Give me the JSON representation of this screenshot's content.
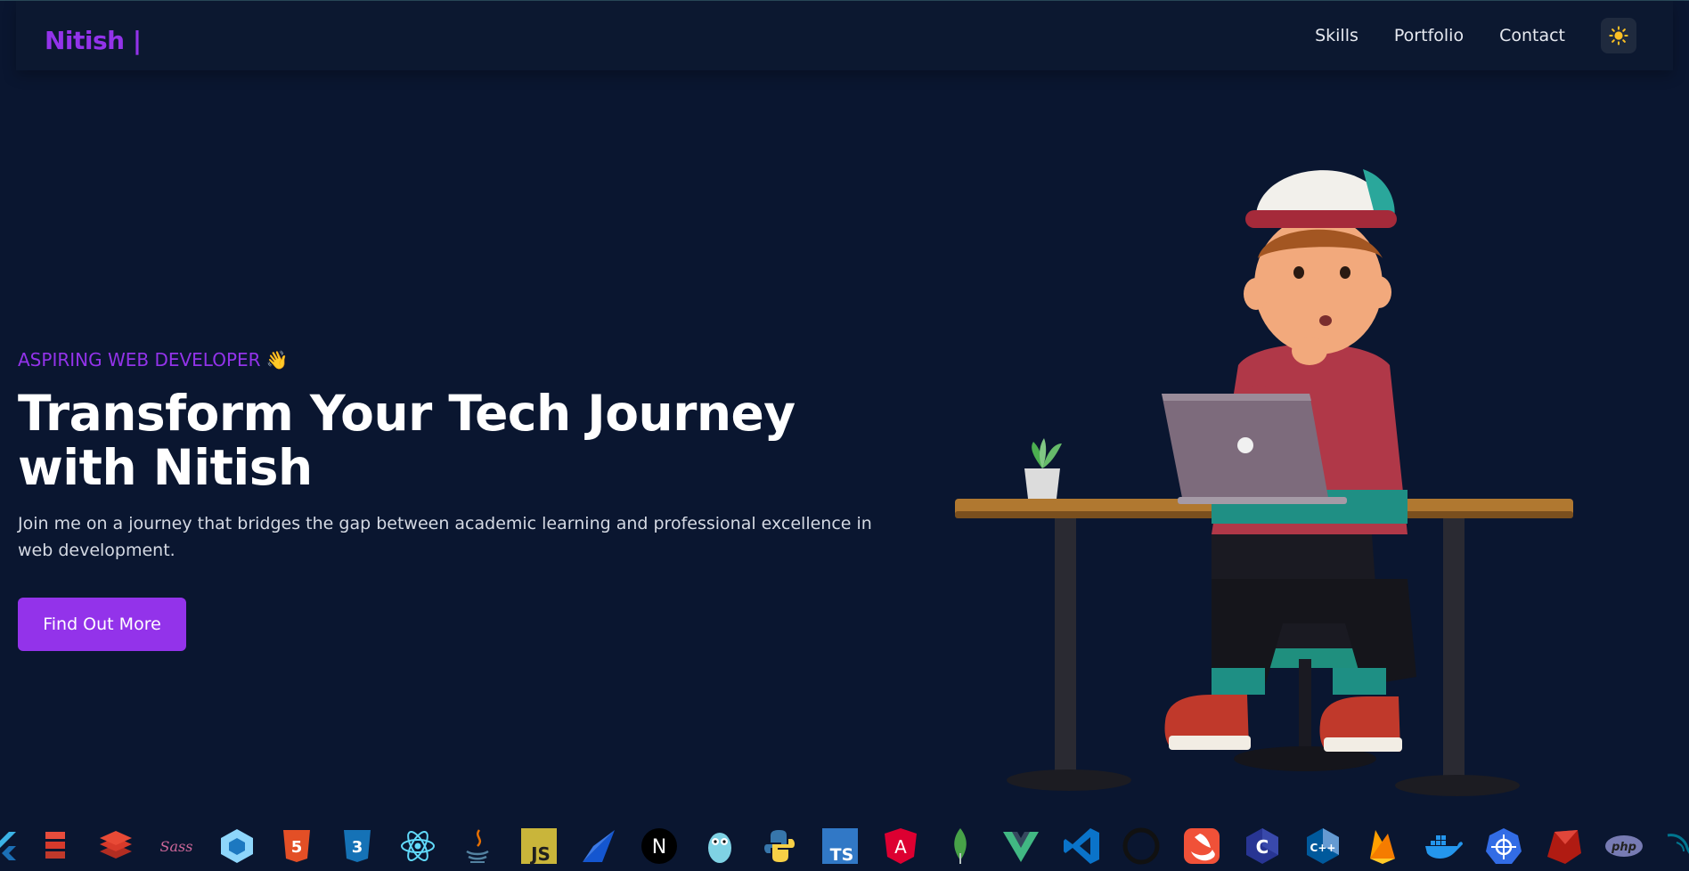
{
  "nav": {
    "logo": "Nitish |",
    "links": [
      "Skills",
      "Portfolio",
      "Contact"
    ],
    "theme_icon": "sun-icon"
  },
  "hero": {
    "eyebrow": "ASPIRING WEB DEVELOPER 👋",
    "title_line1": "Transform Your Tech Journey",
    "title_line2": "with Nitish",
    "description": "Join me on a journey that bridges the gap between academic learning and professional excellence in web development.",
    "cta": "Find Out More",
    "illustration": "developer-at-desk-illustration"
  },
  "tech_icons": {
    "sass_text": "Sass",
    "js_text": "JS",
    "next_text": "N",
    "ts_text": "TS",
    "angular_text": "A",
    "c_text": "C",
    "cpp_text": "C++",
    "php_text": "php",
    "names": [
      "flutter-icon",
      "laravel-icon",
      "redis-icon",
      "sass-icon",
      "webpack-icon",
      "html5-icon",
      "css3-icon",
      "react-icon",
      "java-icon",
      "javascript-icon",
      "vite-icon",
      "nextjs-icon",
      "golang-icon",
      "python-icon",
      "typescript-icon",
      "angular-icon",
      "mongodb-icon",
      "vue-icon",
      "vscode-icon",
      "github-icon",
      "swift-icon",
      "c-icon",
      "cplusplus-icon",
      "firebase-icon",
      "docker-icon",
      "kubernetes-icon",
      "ruby-icon",
      "php-icon",
      "mysql-icon"
    ]
  },
  "colors": {
    "background": "#0a1630",
    "accent": "#9333ea",
    "nav_bg": "#0c1830"
  }
}
